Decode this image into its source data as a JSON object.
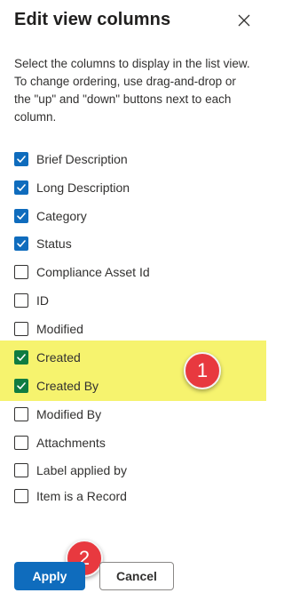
{
  "panel": {
    "title": "Edit view columns",
    "description": "Select the columns to display in the list view. To change ordering, use drag-and-drop or the \"up\" and \"down\" buttons next to each column."
  },
  "icons": {
    "close": "close-icon",
    "check": "checkmark-icon"
  },
  "columns": [
    {
      "label": "Brief Description",
      "checked": true
    },
    {
      "label": "Long Description",
      "checked": true
    },
    {
      "label": "Category",
      "checked": true
    },
    {
      "label": "Status",
      "checked": true
    },
    {
      "label": "Compliance Asset Id",
      "checked": false
    },
    {
      "label": "ID",
      "checked": false
    },
    {
      "label": "Modified",
      "checked": false
    },
    {
      "label": "Created",
      "checked": true
    },
    {
      "label": "Created By",
      "checked": true
    },
    {
      "label": "Modified By",
      "checked": false
    },
    {
      "label": "Attachments",
      "checked": false
    },
    {
      "label": "Label applied by",
      "checked": false
    },
    {
      "label": "Item is a Record",
      "checked": false
    }
  ],
  "annotations": {
    "marker1": "1",
    "marker2": "2"
  },
  "buttons": {
    "apply": "Apply",
    "cancel": "Cancel"
  },
  "colors": {
    "checkbox_normal": "#0f6cbd",
    "checkbox_highlighted": "#107c41",
    "highlight": "#f6f36e",
    "marker": "#e8393f"
  }
}
